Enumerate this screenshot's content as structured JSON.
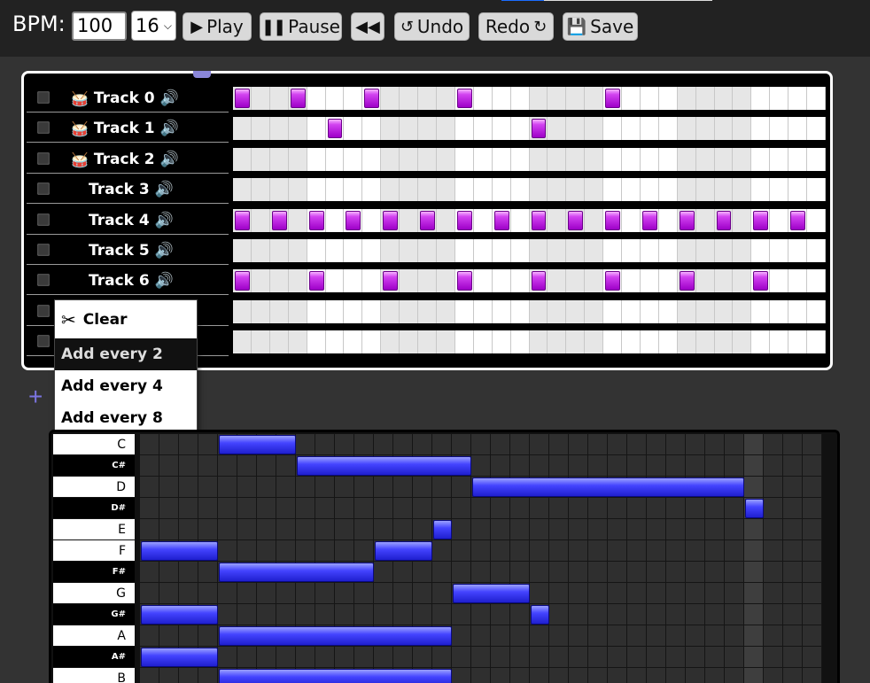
{
  "toolbar": {
    "bpm_label": "BPM:",
    "bpm_value": "100",
    "steps_value": "16",
    "play_label": "Play",
    "pause_label": "Pause",
    "undo_label": "Undo",
    "redo_label": "Redo",
    "save_label": "Save"
  },
  "sequencer": {
    "steps": 32,
    "tracks": [
      {
        "name": "Track 0",
        "drum": true,
        "on": [
          0,
          3,
          7,
          12,
          20
        ]
      },
      {
        "name": "Track 1",
        "drum": true,
        "on": [
          5,
          16
        ]
      },
      {
        "name": "Track 2",
        "drum": true,
        "on": []
      },
      {
        "name": "Track 3",
        "drum": false,
        "on": []
      },
      {
        "name": "Track 4",
        "drum": false,
        "on": [
          0,
          2,
          4,
          6,
          8,
          10,
          12,
          14,
          16,
          18,
          20,
          22,
          24,
          26,
          28,
          30
        ]
      },
      {
        "name": "Track 5",
        "drum": false,
        "on": []
      },
      {
        "name": "Track 6",
        "drum": false,
        "on": [
          0,
          4,
          8,
          12,
          16,
          20,
          24,
          28
        ]
      },
      {
        "name": "",
        "drum": false,
        "on": []
      },
      {
        "name": "",
        "drum": false,
        "on": []
      }
    ],
    "add_track_icon": "+"
  },
  "context_menu": {
    "items": [
      {
        "label": "Clear",
        "icon": "scissors-icon"
      },
      {
        "label": "Add every 2"
      },
      {
        "label": "Add every 4"
      },
      {
        "label": "Add every 8"
      }
    ],
    "highlighted": 1
  },
  "piano_roll": {
    "columns": 35,
    "keys": [
      {
        "label": "C",
        "black": false,
        "notes": [
          [
            4,
            4
          ]
        ]
      },
      {
        "label": "C#",
        "black": true,
        "notes": [
          [
            8,
            9
          ]
        ]
      },
      {
        "label": "D",
        "black": false,
        "notes": [
          [
            17,
            14
          ]
        ]
      },
      {
        "label": "D#",
        "black": true,
        "notes": [
          [
            31,
            1
          ]
        ]
      },
      {
        "label": "E",
        "black": false,
        "notes": [
          [
            15,
            1
          ]
        ]
      },
      {
        "label": "F",
        "black": false,
        "notes": [
          [
            0,
            4
          ],
          [
            12,
            3
          ]
        ]
      },
      {
        "label": "F#",
        "black": true,
        "notes": [
          [
            4,
            8
          ]
        ]
      },
      {
        "label": "G",
        "black": false,
        "notes": [
          [
            16,
            4
          ]
        ]
      },
      {
        "label": "G#",
        "black": true,
        "notes": [
          [
            0,
            4
          ],
          [
            20,
            1
          ]
        ]
      },
      {
        "label": "A",
        "black": false,
        "notes": [
          [
            4,
            12
          ]
        ]
      },
      {
        "label": "A#",
        "black": true,
        "notes": [
          [
            0,
            4
          ]
        ]
      },
      {
        "label": "B",
        "black": false,
        "notes": [
          [
            4,
            12
          ]
        ]
      }
    ]
  }
}
